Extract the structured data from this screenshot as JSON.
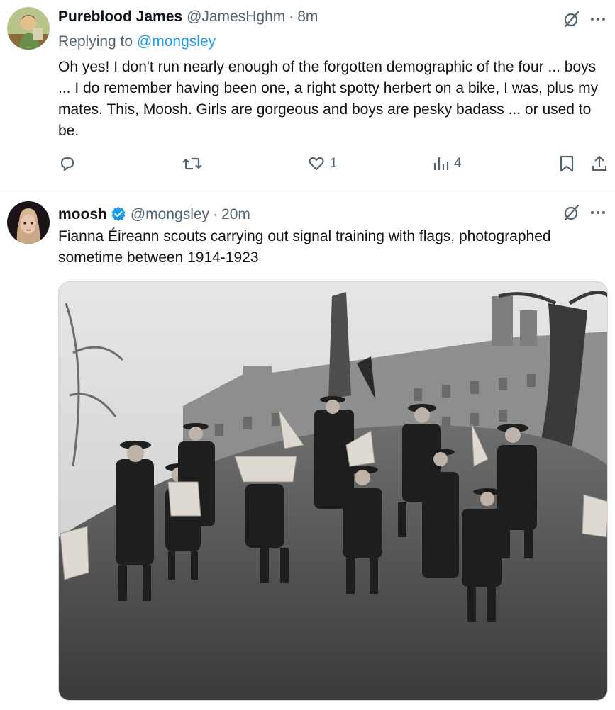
{
  "tweets": [
    {
      "display_name": "Pureblood James",
      "handle": "@JamesHghm",
      "separator": "·",
      "time": "8m",
      "replying_prefix": "Replying to",
      "replying_to": "@mongsley",
      "text": "Oh yes!  I don't run nearly enough of the forgotten demographic of the four ... boys ... I do remember having been one, a right spotty herbert on a bike, I was, plus my mates.  This, Moosh.  Girls are gorgeous and boys are pesky badass ... or used to be.",
      "actions": {
        "reply_count": "",
        "retweet_count": "",
        "like_count": "1",
        "views_count": "4"
      },
      "avatar_icon": "avatar-illustrated-figure"
    },
    {
      "display_name": "moosh",
      "handle": "@mongsley",
      "separator": "·",
      "time": "20m",
      "verified": true,
      "text": "Fianna Éireann scouts carrying out signal training with flags, photographed sometime between 1914-1923",
      "avatar_icon": "avatar-doll-face",
      "media": "black-and-white photo of scouts with flags on a hill"
    }
  ],
  "icons": {
    "grok": "grok-slash-circle-icon",
    "more": "more-dots-icon",
    "reply": "reply-bubble-icon",
    "retweet": "retweet-icon",
    "like": "heart-icon",
    "views": "views-bars-icon",
    "bookmark": "bookmark-icon",
    "share": "share-icon"
  },
  "colors": {
    "text_primary": "#0f1419",
    "text_secondary": "#536471",
    "link": "#1d9bf0",
    "verified": "#1d9bf0",
    "divider": "#e6ecf0"
  }
}
